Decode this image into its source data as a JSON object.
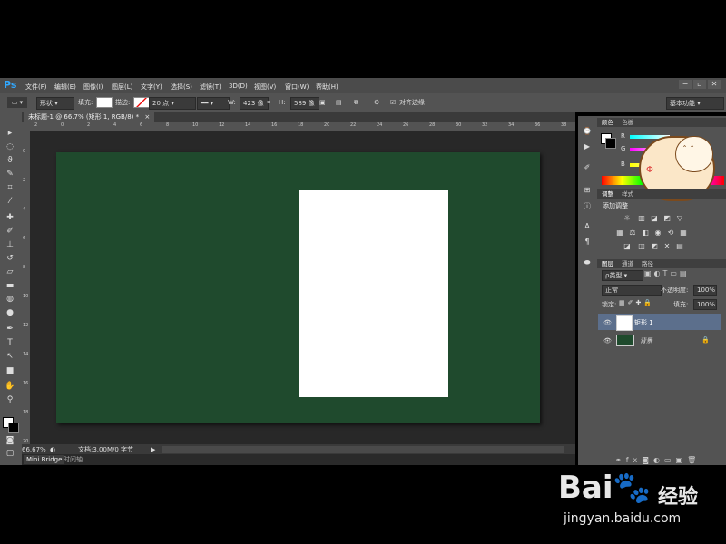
{
  "app": {
    "logo": "Ps"
  },
  "menu": [
    "文件(F)",
    "编辑(E)",
    "图像(I)",
    "图层(L)",
    "文字(Y)",
    "选择(S)",
    "滤镜(T)",
    "3D(D)",
    "视图(V)",
    "窗口(W)",
    "帮助(H)"
  ],
  "window_controls": [
    "−",
    "▫",
    "✕"
  ],
  "options": {
    "mode": "形状",
    "fill_label": "填充:",
    "stroke_label": "描边:",
    "stroke_size": "20 点",
    "w_label": "W:",
    "w_value": "423 像",
    "h_label": "H:",
    "h_value": "589 像",
    "align_edges": "对齐边缘",
    "workspace": "基本功能"
  },
  "document": {
    "tab_title": "未标题-1 @ 66.7% (矩形 1, RGB/8) *",
    "tab_close": "×",
    "canvas_color": "#1f4a2d",
    "shape_color": "#ffffff"
  },
  "ruler_h_ticks": [
    "2",
    "0",
    "2",
    "4",
    "6",
    "8",
    "10",
    "12",
    "14",
    "16",
    "18",
    "20",
    "22",
    "24",
    "26",
    "28",
    "30",
    "32",
    "34",
    "36",
    "38"
  ],
  "ruler_v_ticks": [
    "0",
    "2",
    "4",
    "6",
    "8",
    "10",
    "12",
    "14",
    "16",
    "18",
    "20"
  ],
  "status": {
    "zoom": "66.67%",
    "doc": "文档:3.00M/0 字节"
  },
  "bottom_tabs": [
    "Mini Bridge",
    "时间轴"
  ],
  "panels": {
    "color_tabs": [
      "颜色",
      "色板"
    ],
    "rgb_labels": [
      "R",
      "G",
      "B"
    ],
    "adj_tabs": [
      "调整",
      "样式"
    ],
    "adj_title": "添加调整",
    "layers_tabs": [
      "图层",
      "通道",
      "路径"
    ],
    "kind": "ρ类型",
    "blend": "正常",
    "opacity_label": "不透明度:",
    "opacity": "100%",
    "lock_label": "锁定:",
    "fill_label": "填充:",
    "fill": "100%",
    "layers": [
      {
        "name": "矩形 1",
        "selected": true
      },
      {
        "name": "背景",
        "selected": false
      }
    ]
  },
  "watermark": {
    "brand": "Bai",
    "brand2": "经验",
    "url": "jingyan.baidu.com"
  },
  "icons": [
    "move-icon",
    "marquee-icon",
    "lasso-icon",
    "quick-select-icon",
    "crop-icon",
    "eyedropper-icon",
    "spot-heal-icon",
    "brush-icon",
    "stamp-icon",
    "history-brush-icon",
    "eraser-icon",
    "gradient-icon",
    "blur-icon",
    "dodge-icon",
    "pen-icon",
    "type-icon",
    "path-select-icon",
    "shape-icon",
    "hand-icon",
    "zoom-icon"
  ]
}
